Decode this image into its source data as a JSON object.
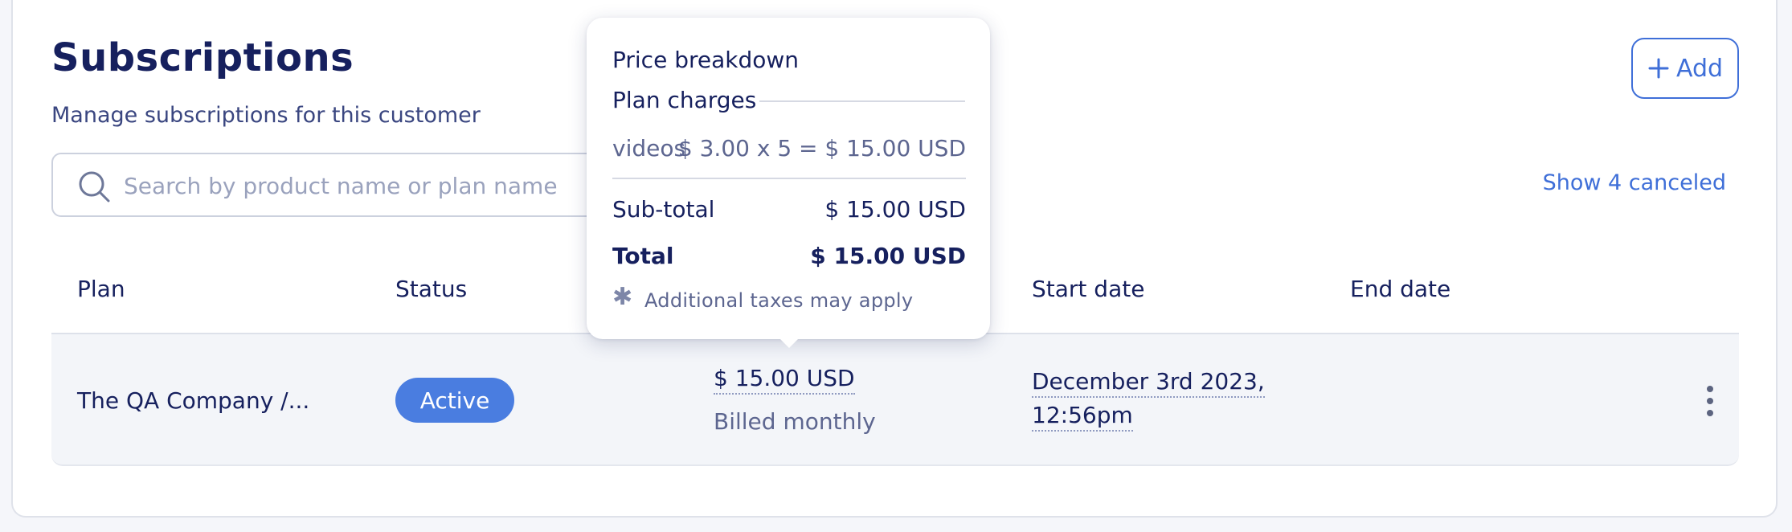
{
  "header": {
    "title": "Subscriptions",
    "subtitle": "Manage subscriptions for this customer",
    "add_label": "Add"
  },
  "search": {
    "placeholder": "Search by product name or plan name",
    "value": ""
  },
  "show_canceled_label": "Show 4 canceled",
  "table": {
    "columns": [
      "Plan",
      "Status",
      "Start date",
      "End date"
    ],
    "rows": [
      {
        "plan": "The QA Company /...",
        "status": "Active",
        "price": "$ 15.00 USD",
        "billing": "Billed monthly",
        "start_date_line1": "December 3rd 2023,",
        "start_date_line2": "12:56pm",
        "end_date": ""
      }
    ]
  },
  "tooltip": {
    "title": "Price breakdown",
    "section": "Plan charges",
    "item_name": "videos",
    "item_calc": "$ 3.00 x 5 = $ 15.00 USD",
    "subtotal_label": "Sub-total",
    "subtotal_value": "$ 15.00 USD",
    "total_label": "Total",
    "total_value": "$ 15.00 USD",
    "note_icon": "✱",
    "note": "Additional taxes may apply"
  },
  "colors": {
    "accent": "#3f6fd8",
    "badge": "#4a7de0",
    "text": "#16205e"
  }
}
